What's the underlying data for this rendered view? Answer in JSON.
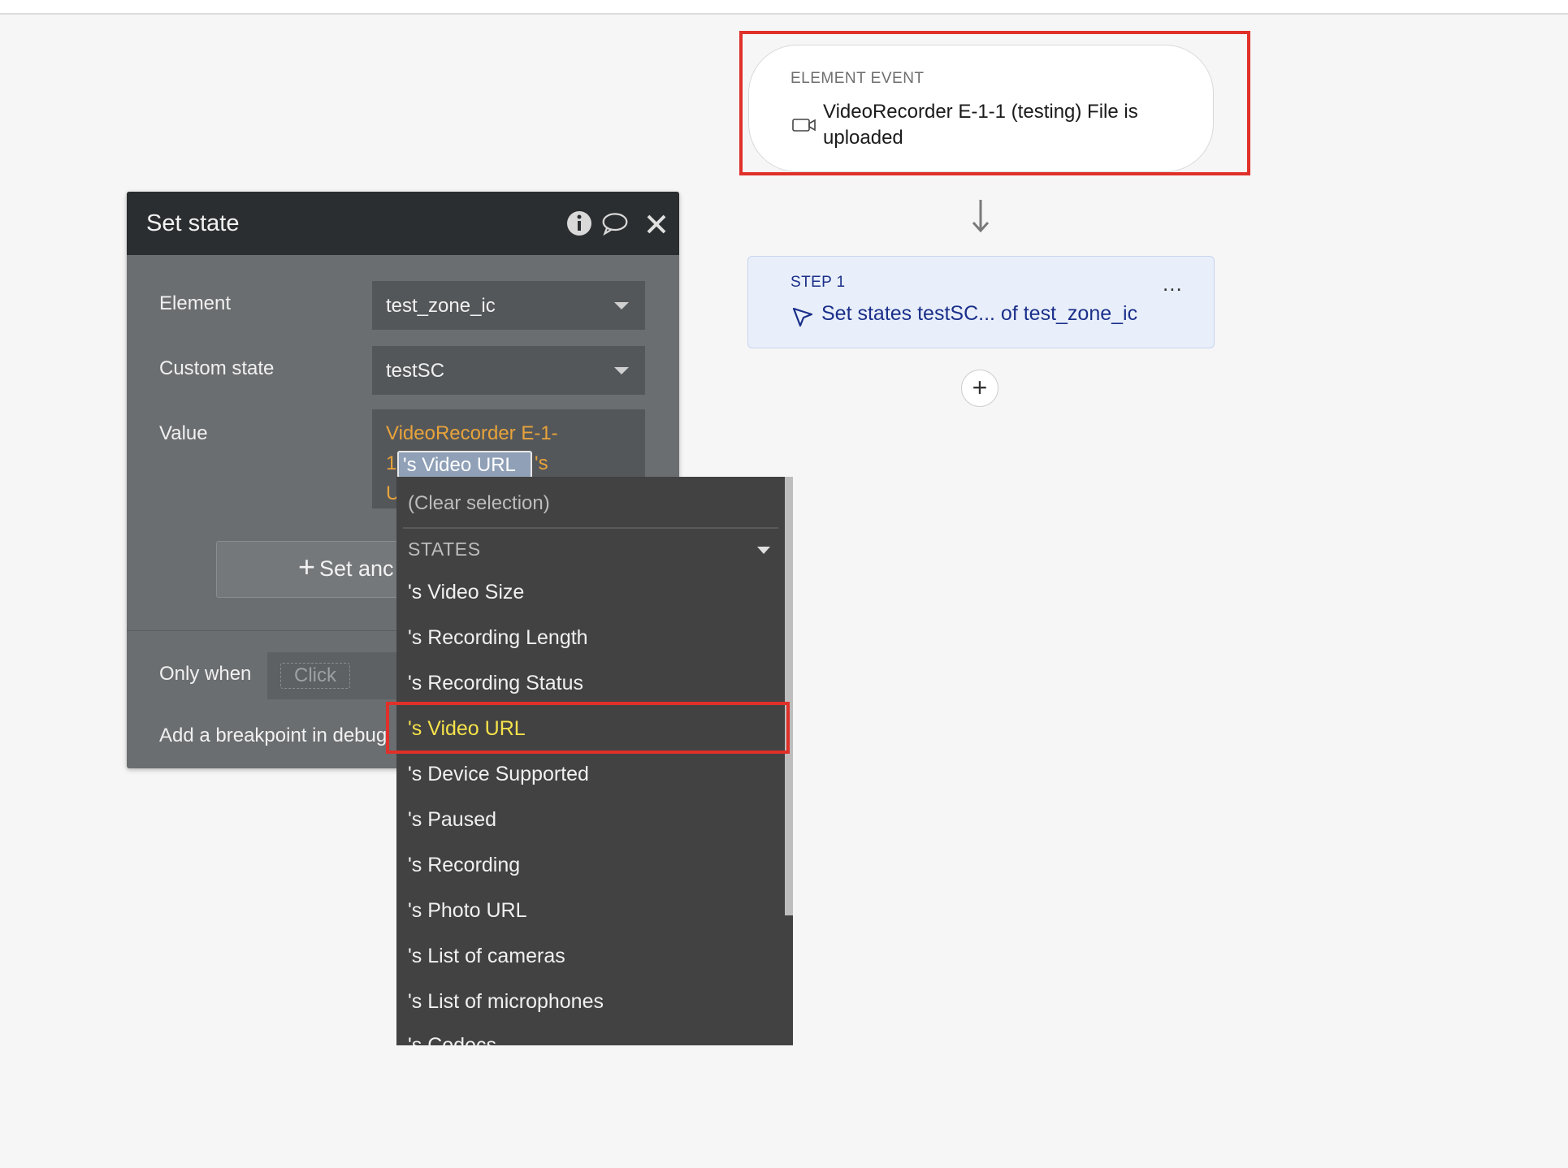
{
  "event": {
    "kicker": "ELEMENT EVENT",
    "title": "VideoRecorder E-1-1 (testing) File is uploaded",
    "icon": "video-camera-icon"
  },
  "step": {
    "label": "STEP 1",
    "text": "Set states testSC... of test_zone_ic",
    "menu": "...",
    "icon": "cursor-arrow-icon"
  },
  "add_step": "+",
  "panel": {
    "title": "Set state",
    "element_label": "Element",
    "element_value": "test_zone_ic",
    "custom_state_label": "Custom state",
    "custom_state_value": "testSC",
    "value_label": "Value",
    "value_line1": "VideoRecorder E-1-",
    "value_line2_prefix": "1",
    "value_chip": "'s Video URL",
    "value_line2_suffix": "'s",
    "value_line3": "U",
    "set_another": "Set anc",
    "set_another_plus": "+",
    "only_when_label": "Only when",
    "only_when_placeholder": "Click",
    "breakpoint_label": "Add a breakpoint in debug"
  },
  "menu": {
    "clear": "(Clear selection)",
    "section": "STATES",
    "items": [
      "'s Video Size",
      "'s Recording Length",
      "'s Recording Status",
      "'s Video URL",
      "'s Device Supported",
      "'s Paused",
      "'s Recording",
      "'s Photo URL",
      "'s List of cameras",
      "'s List of microphones",
      "'s Codecs"
    ],
    "active_index": 3
  },
  "colors": {
    "highlight": "#e0302a",
    "value_text": "#e8a33a",
    "active_item": "#f5e24a",
    "step_text": "#1a2f8a"
  }
}
